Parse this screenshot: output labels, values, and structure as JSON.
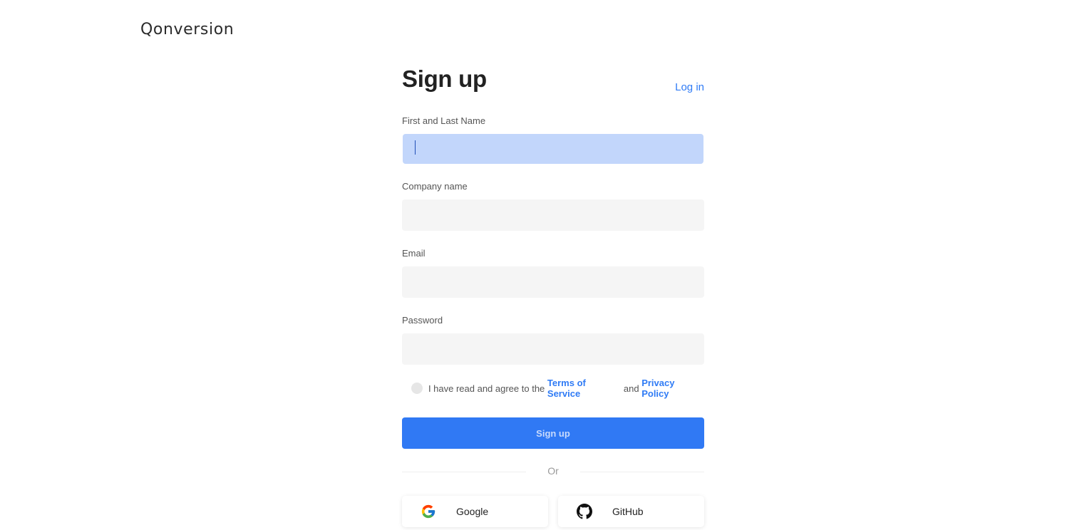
{
  "brand": {
    "logo_text": "Qonversion"
  },
  "header": {
    "title": "Sign up",
    "login_label": "Log in"
  },
  "fields": {
    "name": {
      "label": "First and Last Name",
      "value": "",
      "placeholder": ""
    },
    "company": {
      "label": "Company name",
      "value": "",
      "placeholder": ""
    },
    "email": {
      "label": "Email",
      "value": "",
      "placeholder": ""
    },
    "password": {
      "label": "Password",
      "value": "",
      "placeholder": ""
    }
  },
  "terms": {
    "prefix": "I have read and agree to the ",
    "terms_link": "Terms of Service",
    "middle": " and ",
    "privacy_link": "Privacy Policy",
    "checked": false
  },
  "actions": {
    "signup_label": "Sign up",
    "divider_text": "Or"
  },
  "social": {
    "google_label": "Google",
    "github_label": "GitHub"
  },
  "colors": {
    "accent": "#3079f4",
    "link": "#2f7bf5",
    "active_input": "#c2d6fb",
    "input_bg": "#f5f5f5"
  },
  "icons": {
    "google": "google-icon",
    "github": "github-icon"
  }
}
